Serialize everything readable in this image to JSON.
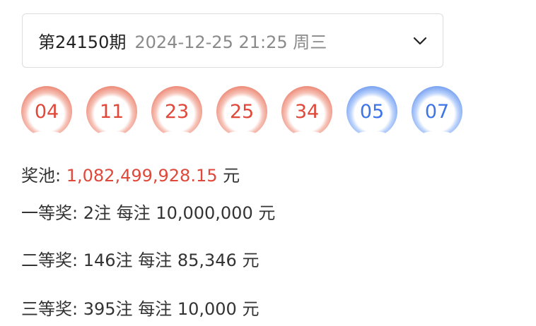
{
  "issue": {
    "number": "第24150期",
    "datetime": "2024-12-25 21:25 周三",
    "dropdown_icon": "chevron-down-icon"
  },
  "balls": [
    {
      "value": "04",
      "color": "red"
    },
    {
      "value": "11",
      "color": "red"
    },
    {
      "value": "23",
      "color": "red"
    },
    {
      "value": "25",
      "color": "red"
    },
    {
      "value": "34",
      "color": "red"
    },
    {
      "value": "05",
      "color": "blue"
    },
    {
      "value": "07",
      "color": "blue"
    }
  ],
  "pool": {
    "label": "奖池:",
    "amount": "1,082,499,928.15",
    "unit": "元"
  },
  "prizes": [
    {
      "level": "一等奖:",
      "count": "2注",
      "per_label": "每注",
      "amount": "10,000,000",
      "unit": "元"
    },
    {
      "level": "二等奖:",
      "count": "146注",
      "per_label": "每注",
      "amount": "85,346",
      "unit": "元"
    },
    {
      "level": "三等奖:",
      "count": "395注",
      "per_label": "每注",
      "amount": "10,000",
      "unit": "元"
    }
  ],
  "colors": {
    "red_ball": "#e8715f",
    "blue_ball": "#5b88ea",
    "highlight": "#e0483a"
  }
}
